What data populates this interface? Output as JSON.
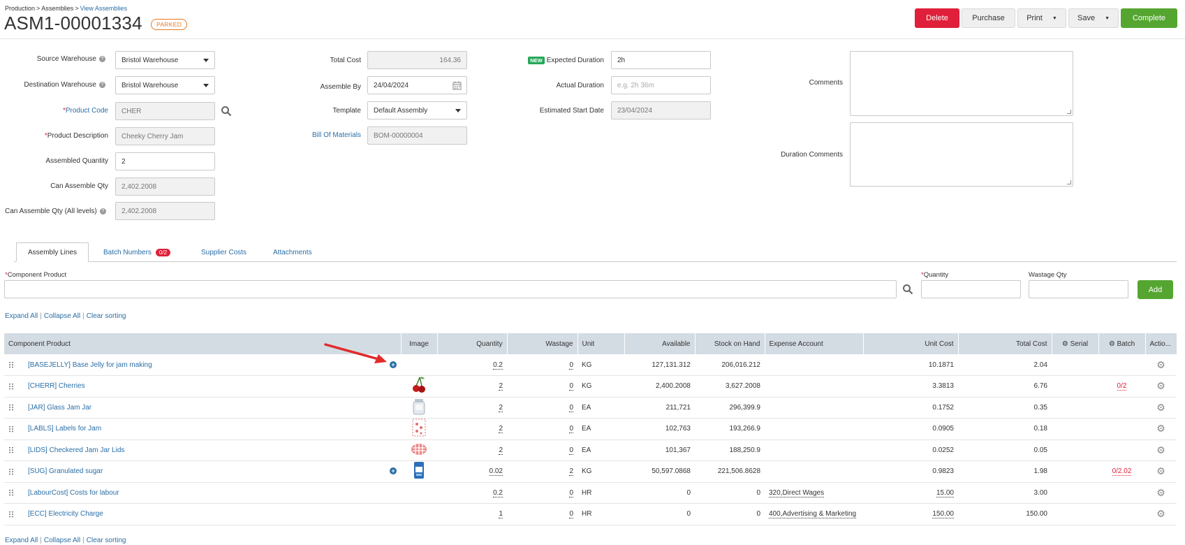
{
  "breadcrumb": {
    "items": [
      "Production",
      "Assemblies",
      "View Assemblies"
    ],
    "separator": ">"
  },
  "title": "ASM1-00001334",
  "status": "PARKED",
  "toolbar": {
    "delete": "Delete",
    "purchase": "Purchase",
    "print": "Print",
    "save": "Save",
    "complete": "Complete"
  },
  "form": {
    "source_warehouse": {
      "label": "Source Warehouse",
      "value": "Bristol Warehouse"
    },
    "destination_warehouse": {
      "label": "Destination Warehouse",
      "value": "Bristol Warehouse"
    },
    "product_code": {
      "label": "Product Code",
      "value": "CHER"
    },
    "product_description": {
      "label": "Product Description",
      "value": "Cheeky Cherry Jam"
    },
    "assembled_quantity": {
      "label": "Assembled Quantity",
      "value": "2"
    },
    "can_assemble_qty": {
      "label": "Can Assemble Qty",
      "value": "2,402.2008"
    },
    "can_assemble_qty_all": {
      "label": "Can Assemble Qty (All levels)",
      "value": "2,402.2008"
    },
    "total_cost": {
      "label": "Total Cost",
      "value": "164.36"
    },
    "assemble_by": {
      "label": "Assemble By",
      "value": "24/04/2024"
    },
    "template": {
      "label": "Template",
      "value": "Default Assembly"
    },
    "bill_of_materials": {
      "label": "Bill Of Materials",
      "value": "BOM-00000004"
    },
    "new_badge": "NEW",
    "expected_duration": {
      "label": "Expected Duration",
      "value": "2h"
    },
    "actual_duration": {
      "label": "Actual Duration",
      "placeholder": "e.g. 2h 36m"
    },
    "estimated_start": {
      "label": "Estimated Start Date",
      "value": "23/04/2024"
    },
    "comments": {
      "label": "Comments"
    },
    "duration_comments": {
      "label": "Duration Comments"
    }
  },
  "tabs": [
    {
      "label": "Assembly Lines",
      "active": true
    },
    {
      "label": "Batch Numbers",
      "badge": "0/2"
    },
    {
      "label": "Supplier Costs"
    },
    {
      "label": "Attachments"
    }
  ],
  "entry": {
    "component_label": "Component Product",
    "quantity_label": "Quantity",
    "wastage_label": "Wastage Qty",
    "add": "Add"
  },
  "list_links": {
    "expand": "Expand All",
    "collapse": "Collapse All",
    "clear": "Clear sorting"
  },
  "table": {
    "columns": [
      "Component Product",
      "Image",
      "Quantity",
      "Wastage",
      "Unit",
      "Available",
      "Stock on Hand",
      "Expense Account",
      "Unit Cost",
      "Total Cost",
      "Serial",
      "Batch",
      "Actio..."
    ],
    "rows": [
      {
        "product": "[BASEJELLY] Base Jelly for jam making",
        "plus": true,
        "image": "",
        "quantity": "0.2",
        "wastage": "0",
        "unit": "KG",
        "available": "127,131.312",
        "soh": "206,016.212",
        "expense": "",
        "unit_cost": "10.1871",
        "total_cost": "2.04",
        "batch": ""
      },
      {
        "product": "[CHERR] Cherries",
        "plus": false,
        "image": "cherry",
        "quantity": "2",
        "wastage": "0",
        "unit": "KG",
        "available": "2,400.2008",
        "soh": "3,627.2008",
        "expense": "",
        "unit_cost": "3.3813",
        "total_cost": "6.76",
        "batch": "0/2"
      },
      {
        "product": "[JAR] Glass Jam Jar",
        "plus": false,
        "image": "jar",
        "quantity": "2",
        "wastage": "0",
        "unit": "EA",
        "available": "211,721",
        "soh": "296,399.9",
        "expense": "",
        "unit_cost": "0.1752",
        "total_cost": "0.35",
        "batch": ""
      },
      {
        "product": "[LABLS] Labels for Jam",
        "plus": false,
        "image": "labels",
        "quantity": "2",
        "wastage": "0",
        "unit": "EA",
        "available": "102,763",
        "soh": "193,266.9",
        "expense": "",
        "unit_cost": "0.0905",
        "total_cost": "0.18",
        "batch": ""
      },
      {
        "product": "[LIDS] Checkered Jam Jar Lids",
        "plus": false,
        "image": "lid",
        "quantity": "2",
        "wastage": "0",
        "unit": "EA",
        "available": "101,367",
        "soh": "188,250.9",
        "expense": "",
        "unit_cost": "0.0252",
        "total_cost": "0.05",
        "batch": ""
      },
      {
        "product": "[SUG] Granulated sugar",
        "plus": true,
        "image": "sugar",
        "quantity": "0.02",
        "wastage": "2",
        "unit": "KG",
        "available": "50,597.0868",
        "soh": "221,506.8628",
        "expense": "",
        "unit_cost": "0.9823",
        "total_cost": "1.98",
        "batch": "0/2.02"
      },
      {
        "product": "[LabourCost] Costs for labour",
        "plus": false,
        "image": "",
        "quantity": "0.2",
        "wastage": "0",
        "unit": "HR",
        "available": "0",
        "soh": "0",
        "expense": "320,Direct Wages",
        "unit_cost": "15.00",
        "total_cost": "3.00",
        "batch": ""
      },
      {
        "product": "[ECC] Electricity Charge",
        "plus": false,
        "image": "",
        "quantity": "1",
        "wastage": "0",
        "unit": "HR",
        "available": "0",
        "soh": "0",
        "expense": "400,Advertising & Marketing",
        "unit_cost": "150.00",
        "total_cost": "150.00",
        "batch": ""
      }
    ]
  },
  "colors": {
    "delete": "#e0203a",
    "complete": "#55a630",
    "link": "#2a6ea6",
    "header_bg": "#d3dbe3",
    "parked": "#e87722"
  }
}
